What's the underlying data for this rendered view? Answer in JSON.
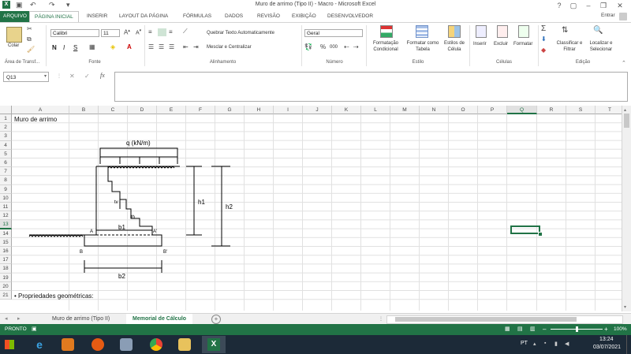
{
  "window": {
    "title": "Muro de arrimo (Tipo II) - Macro - Microsoft Excel",
    "help": "?",
    "user": "Entrar"
  },
  "tabs": [
    "ARQUIVO",
    "PÁGINA INICIAL",
    "INSERIR",
    "LAYOUT DA PÁGINA",
    "FÓRMULAS",
    "DADOS",
    "REVISÃO",
    "EXIBIÇÃO",
    "DESENVOLVEDOR"
  ],
  "ribbon": {
    "clipboard": {
      "paste": "Colar",
      "label": "Área de Transf..."
    },
    "font": {
      "name": "Calibri",
      "size": "11",
      "bold": "N",
      "italic": "I",
      "underline": "S",
      "label": "Fonte"
    },
    "alignment": {
      "wrap": "Quebrar Texto Automaticamente",
      "merge": "Mesclar e Centralizar",
      "label": "Alinhamento"
    },
    "number": {
      "format": "Geral",
      "percent": "%",
      "thousands": "000",
      "label": "Número"
    },
    "styles": {
      "conditional": "Formatação Condicional",
      "as_table": "Formatar como Tabela",
      "cell_styles": "Estilos de Célula",
      "label": "Estilo"
    },
    "cells": {
      "insert": "Inserir",
      "delete": "Excluir",
      "format": "Formatar",
      "label": "Células"
    },
    "editing": {
      "sort": "Classificar e Filtrar",
      "find": "Localizar e Selecionar",
      "label": "Edição"
    }
  },
  "formula_bar": {
    "name_box": "Q13",
    "fx": "fx",
    "value": ""
  },
  "columns": [
    "A",
    "B",
    "C",
    "D",
    "E",
    "F",
    "G",
    "H",
    "I",
    "J",
    "K",
    "L",
    "M",
    "N",
    "O",
    "P",
    "Q",
    "R",
    "S",
    "T"
  ],
  "rows": [
    "1",
    "2",
    "3",
    "4",
    "5",
    "6",
    "7",
    "8",
    "9",
    "10",
    "11",
    "12",
    "13",
    "14",
    "15",
    "16",
    "17",
    "18",
    "19",
    "20",
    "21"
  ],
  "cells": {
    "a1": "Muro de arrimo",
    "a20": "• Propriedades geométricas:"
  },
  "drawing": {
    "q_label": "q (kN/m)",
    "tv": "tv",
    "th": "th",
    "b1": "b1",
    "b2": "b2",
    "h1": "h1",
    "h2": "h2",
    "pt_a": "A",
    "pt_a_prime": "A'",
    "pt_b": "B",
    "pt_b_prime": "B'"
  },
  "sheets": [
    {
      "name": "Muro de arrimo (Tipo II)",
      "active": false
    },
    {
      "name": "Memorial de Cálculo",
      "active": true
    }
  ],
  "status": {
    "ready": "PRONTO",
    "zoom": "100%"
  },
  "taskbar": {
    "lang": "PT",
    "time": "13:24",
    "date": "03/07/2021"
  }
}
